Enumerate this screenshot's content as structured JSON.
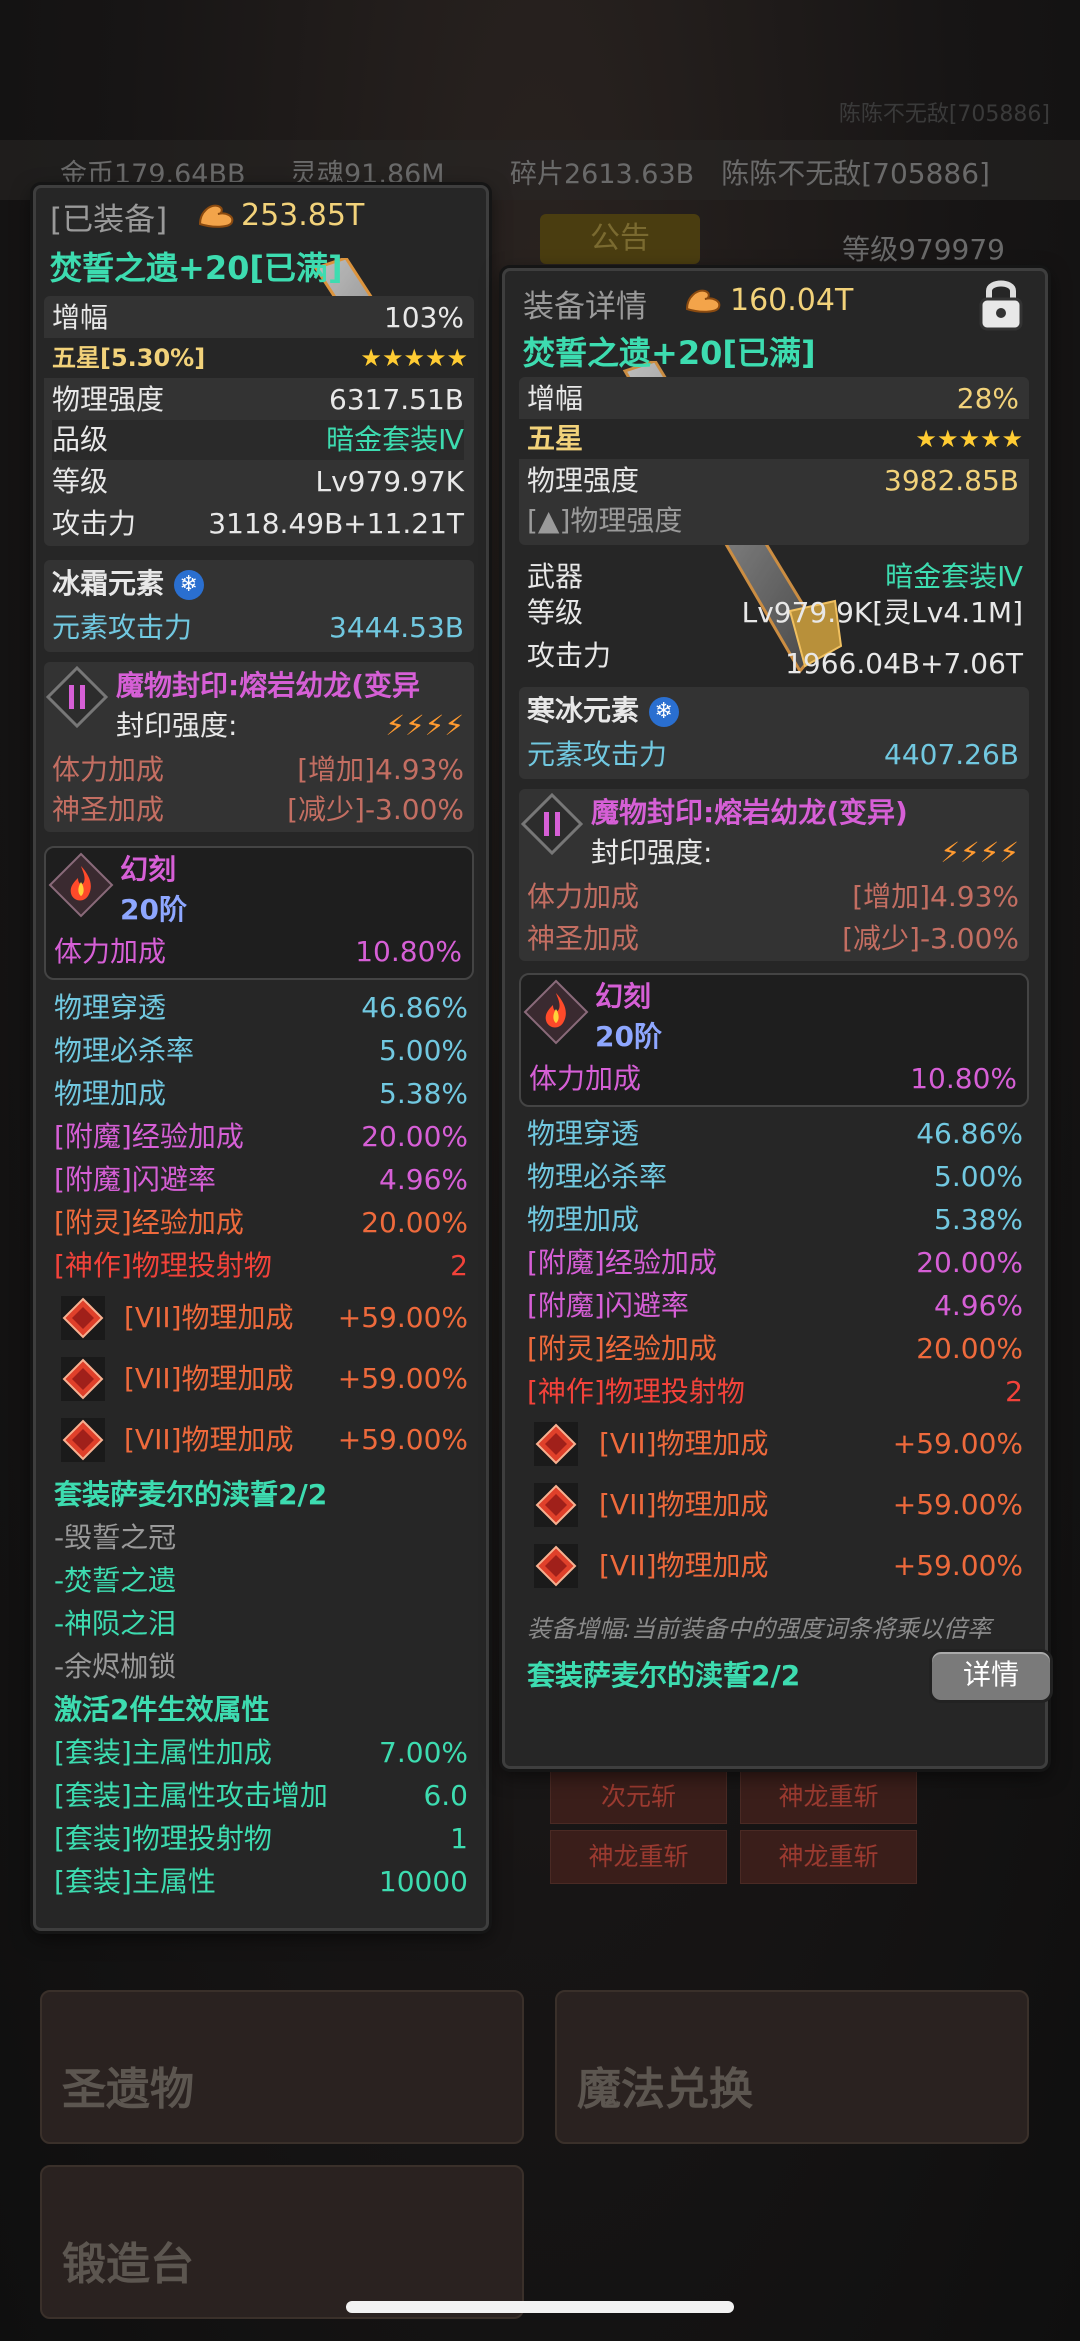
{
  "background": {
    "ghost_player": "陈陈不无敌[705886]",
    "resources": [
      {
        "icon": "coin-icon",
        "text": "金币179.64BB"
      },
      {
        "icon": "soul-icon",
        "text": "灵魂91.86M"
      },
      {
        "icon": "fragment-icon",
        "text": "碎片2613.63B"
      }
    ],
    "player_name": "陈陈不无敌[705886]",
    "notice_label": "公告",
    "level_text": "等级979979",
    "skills": [
      "次元斩",
      "神龙重斩",
      "神龙重斩",
      "神龙重斩"
    ],
    "tiles": [
      "圣遗物",
      "魔法兑换",
      "锻造台"
    ]
  },
  "left_panel": {
    "header": "[已装备]",
    "power": "253.85T",
    "title": "焚誓之遗+20[已满]",
    "amp": {
      "label": "增幅",
      "value": "103%"
    },
    "star_label": "五星[5.30%]",
    "stars": "★★★★★",
    "stats": [
      {
        "label": "物理强度",
        "value": "6317.51B"
      },
      {
        "label": "品级",
        "value": "暗金套装Ⅳ"
      },
      {
        "label": "等级",
        "value": "Lv979.97K"
      },
      {
        "label": "攻击力",
        "value": "3118.49B+11.21T"
      }
    ],
    "element_name": "冰霜元素",
    "element_attack": {
      "label": "元素攻击力",
      "value": "3444.53B"
    },
    "seal_name": "魔物封印:熔岩幼龙(变异",
    "seal_strength_label": "封印强度:",
    "seal_stats": [
      {
        "label": "体力加成",
        "value": "[增加]4.93%"
      },
      {
        "label": "神圣加成",
        "value": "[减少]-3.00%"
      }
    ],
    "illusion_name": "幻刻",
    "illusion_tier": "20阶",
    "illusion_stat": {
      "label": "体力加成",
      "value": "10.80%"
    },
    "sub_stats": [
      {
        "label": "物理穿透",
        "value": "46.86%",
        "color": "cyan"
      },
      {
        "label": "物理必杀率",
        "value": "5.00%",
        "color": "cyan"
      },
      {
        "label": "物理加成",
        "value": "5.38%",
        "color": "cyan"
      },
      {
        "label": "[附魔]经验加成",
        "value": "20.00%",
        "color": "pink"
      },
      {
        "label": "[附魔]闪避率",
        "value": "4.96%",
        "color": "pink"
      },
      {
        "label": "[附灵]经验加成",
        "value": "20.00%",
        "color": "orange"
      },
      {
        "label": "[神作]物理投射物",
        "value": "2",
        "color": "red"
      }
    ],
    "gem_stats": [
      {
        "label": "[VII]物理加成",
        "value": "+59.00%"
      },
      {
        "label": "[VII]物理加成",
        "value": "+59.00%"
      },
      {
        "label": "[VII]物理加成",
        "value": "+59.00%"
      }
    ],
    "set_title": "套装萨麦尔的渎誓2/2",
    "set_items": [
      "-毁誓之冠",
      "-焚誓之遗",
      "-神陨之泪",
      "-余烬枷锁"
    ],
    "set_active_title": "激活2件生效属性",
    "set_effects": [
      {
        "label": "[套装]主属性加成",
        "value": "7.00%"
      },
      {
        "label": "[套装]主属性攻击增加",
        "value": "6.0"
      },
      {
        "label": "[套装]物理投射物",
        "value": "1"
      },
      {
        "label": "[套装]主属性",
        "value": "10000"
      }
    ]
  },
  "right_panel": {
    "header": "装备详情",
    "power": "160.04T",
    "title": "焚誓之遗+20[已满]",
    "amp": {
      "label": "增幅",
      "value": "28%"
    },
    "star_label": "五星",
    "stars": "★★★★★",
    "strength": {
      "label": "物理强度",
      "value": "3982.85B"
    },
    "strength_up": "[▲]物理强度",
    "weapon": {
      "label": "武器",
      "value": "暗金套装Ⅳ"
    },
    "level": {
      "label": "等级",
      "value": "Lv979.9K[灵Lv4.1M]"
    },
    "attack": {
      "label": "攻击力",
      "value": "1966.04B+7.06T"
    },
    "element_name": "寒冰元素",
    "element_attack": {
      "label": "元素攻击力",
      "value": "4407.26B"
    },
    "seal_name": "魔物封印:熔岩幼龙(变异)",
    "seal_strength_label": "封印强度:",
    "seal_stats": [
      {
        "label": "体力加成",
        "value": "[增加]4.93%"
      },
      {
        "label": "神圣加成",
        "value": "[减少]-3.00%"
      }
    ],
    "illusion_name": "幻刻",
    "illusion_tier": "20阶",
    "illusion_stat": {
      "label": "体力加成",
      "value": "10.80%"
    },
    "sub_stats": [
      {
        "label": "物理穿透",
        "value": "46.86%",
        "color": "cyan"
      },
      {
        "label": "物理必杀率",
        "value": "5.00%",
        "color": "cyan"
      },
      {
        "label": "物理加成",
        "value": "5.38%",
        "color": "cyan"
      },
      {
        "label": "[附魔]经验加成",
        "value": "20.00%",
        "color": "pink"
      },
      {
        "label": "[附魔]闪避率",
        "value": "4.96%",
        "color": "pink"
      },
      {
        "label": "[附灵]经验加成",
        "value": "20.00%",
        "color": "orange"
      },
      {
        "label": "[神作]物理投射物",
        "value": "2",
        "color": "red"
      }
    ],
    "gem_stats": [
      {
        "label": "[VII]物理加成",
        "value": "+59.00%"
      },
      {
        "label": "[VII]物理加成",
        "value": "+59.00%"
      },
      {
        "label": "[VII]物理加成",
        "value": "+59.00%"
      }
    ],
    "note": "装备增幅:当前装备中的强度词条将乘以倍率",
    "set_title": "套装萨麦尔的渎誓2/2",
    "detail_button": "详情"
  }
}
